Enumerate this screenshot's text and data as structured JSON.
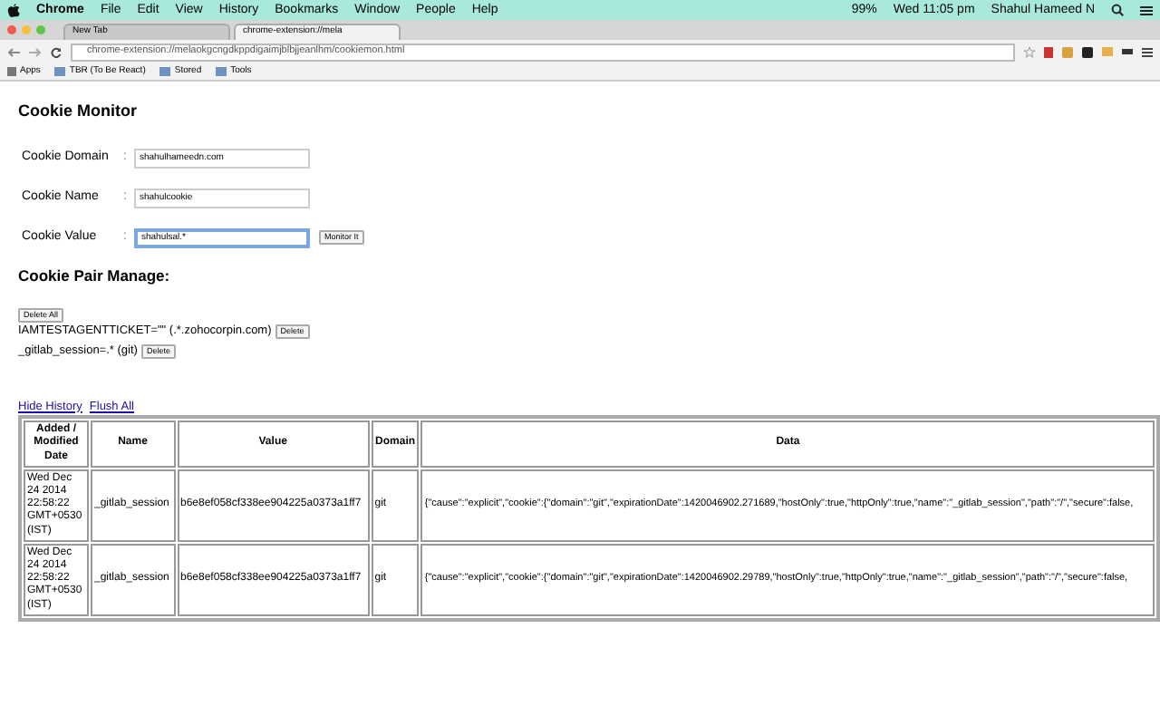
{
  "menubar": {
    "app": "Chrome",
    "items": [
      "File",
      "Edit",
      "View",
      "History",
      "Bookmarks",
      "Window",
      "People",
      "Help"
    ],
    "battery": "99%",
    "clock": "Wed 11:05 pm",
    "user": "Shahul Hameed N"
  },
  "tabs": [
    {
      "label": "New Tab",
      "selected": false
    },
    {
      "label": "chrome-extension://mela",
      "selected": true
    }
  ],
  "address": "chrome-extension://melaokgcngdkppdigaimjblbjjeanlhm/cookiemon.html",
  "bookmarks": [
    "Apps",
    "TBR (To Be React)",
    "Stored",
    "Tools"
  ],
  "title": "Cookie Monitor",
  "fields": [
    {
      "label": "Cookie Domain",
      "separator": ":",
      "value": "shahulhameedn.com",
      "focused": false
    },
    {
      "label": "Cookie Name",
      "separator": ":",
      "value": "shahulcookie",
      "focused": false
    },
    {
      "label": "Cookie Value",
      "separator": ":",
      "value": "shahulsal.*",
      "focused": true
    }
  ],
  "monitor_button": "Monitor It",
  "pairs_title": "Cookie Pair Manage:",
  "delete_all": "Delete All",
  "pairs": [
    {
      "text": "IAMTESTAGENTTICKET=\"\" (.*.zohocorpin.com)",
      "button": "Delete"
    },
    {
      "text": "_gitlab_session=.* (git)",
      "button": "Delete"
    }
  ],
  "links": [
    "Hide History",
    "Flush All"
  ],
  "table": {
    "columns": [
      "Added / Modified Date",
      "Name",
      "Value",
      "Domain",
      "Data"
    ],
    "rows": [
      [
        "Wed Dec 24 2014 22:58:22 GMT+0530 (IST)",
        "_gitlab_session",
        "b6e8ef058cf338ee904225a0373a1ff7",
        "git",
        "{\"cause\":\"explicit\",\"cookie\":{\"domain\":\"git\",\"expirationDate\":1420046902.271689,\"hostOnly\":true,\"httpOnly\":true,\"name\":\"_gitlab_session\",\"path\":\"/\",\"secure\":false,"
      ],
      [
        "Wed Dec 24 2014 22:58:22 GMT+0530 (IST)",
        "_gitlab_session",
        "b6e8ef058cf338ee904225a0373a1ff7",
        "git",
        "{\"cause\":\"explicit\",\"cookie\":{\"domain\":\"git\",\"expirationDate\":1420046902.29789,\"hostOnly\":true,\"httpOnly\":true,\"name\":\"_gitlab_session\",\"path\":\"/\",\"secure\":false,"
      ]
    ]
  }
}
